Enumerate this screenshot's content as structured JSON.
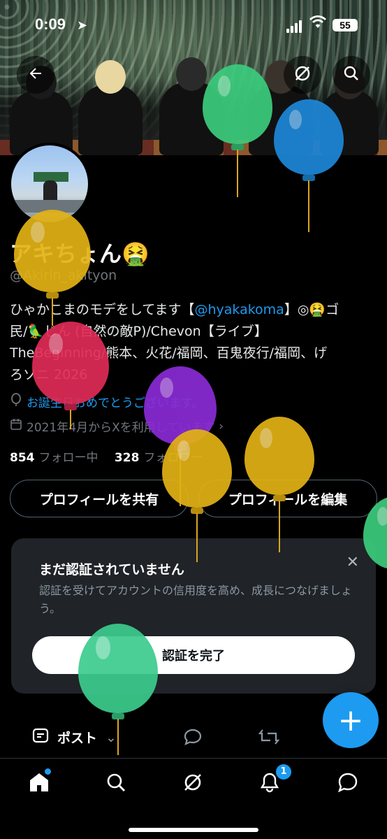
{
  "status_bar": {
    "time": "0:09",
    "battery": "55"
  },
  "profile": {
    "display_name": "アキちょん",
    "name_emoji": "🤮",
    "handle": "@Akirin_akityon",
    "bio_line1_prefix": "ひゃかこまのモデをしてます【",
    "bio_mention": "@hyakakoma",
    "bio_line1_suffix": "】◎🤮ゴ",
    "bio_line2": "民/🦜じん (自然の敵P)/Chevon【ライブ】",
    "bio_line3": "TheBeginning/熊本、火花/福岡、百鬼夜行/福岡、げ",
    "bio_line4": "ろソニ 2026",
    "birthday_text": "お誕生日おめでとうございます。",
    "joined_text": "2021年4月からXを利用しています",
    "following_count": "854",
    "following_label": "フォロー中",
    "followers_count": "328",
    "followers_label": "フォロワー"
  },
  "actions": {
    "share_label": "プロフィールを共有",
    "edit_label": "プロフィールを編集"
  },
  "verification_card": {
    "title": "まだ認証されていません",
    "description": "認証を受けてアカウントの信用度を高め、成長につなげましょう。",
    "cta_label": "認証を完了"
  },
  "composer": {
    "post_label": "ポスト"
  },
  "tabbar": {
    "notifications_badge": "1"
  },
  "icons": {
    "back": "back-arrow-icon",
    "grok": "grok-icon",
    "search": "search-icon",
    "fab": "compose-plus-icon",
    "home": "home-icon",
    "notifications": "bell-icon",
    "messages": "message-icon"
  },
  "colors": {
    "accent": "#1d9bf0",
    "background": "#000000",
    "card": "#202327",
    "muted": "#71767b"
  }
}
